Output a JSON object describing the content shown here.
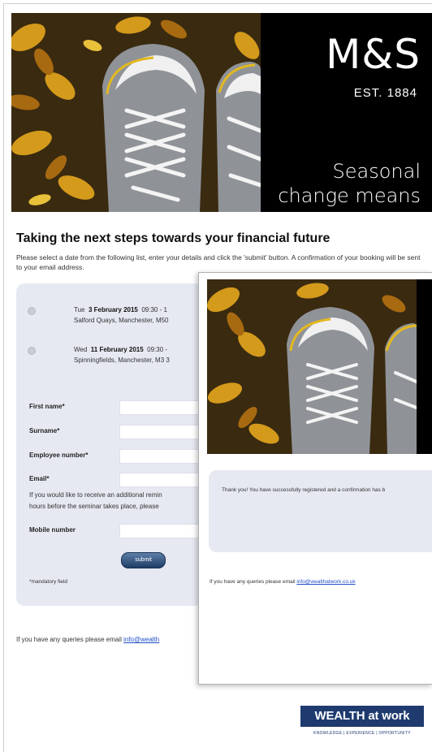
{
  "banner": {
    "brand": "M&S",
    "established": "EST. 1884",
    "tagline_line1": "Seasonal",
    "tagline_line2": "change means"
  },
  "page": {
    "heading": "Taking the next steps towards your financial future",
    "intro": "Please select a date from the following list, enter your details and click the 'submit' button. A confirmation of your booking will be sent to your email address."
  },
  "seminars": [
    {
      "day": "Tue",
      "date": "3 February 2015",
      "time": "09:30 - 1",
      "venue": "Salford Quays, Manchester, M50"
    },
    {
      "day": "Wed",
      "date": "11 February 2015",
      "time": "09:30 -",
      "venue": "Spinningfields, Manchester, M3 3"
    }
  ],
  "form": {
    "first_name": "First name*",
    "surname": "Surname*",
    "employee_number": "Employee number*",
    "email": "Email*",
    "reminder_line1": "If you would like to receive an additional remin",
    "reminder_line2": "hours before the seminar takes place, please",
    "mobile": "Mobile number",
    "submit": "submit",
    "mandatory": "*mandatory field"
  },
  "footer": {
    "queries": "If you have any queries please email",
    "email_link": "info@wealth"
  },
  "confirmation": {
    "message": "Thank you! You have successfully registered and a confirmation has b",
    "queries": "If you have any queries please email",
    "email_link": "info@wealthatwork.co.uk"
  },
  "sponsor": {
    "logo_text": "WEALTH at work",
    "strap": "KNOWLEDGE | EXPERIENCE | OPPORTUNITY"
  },
  "colors": {
    "accent": "#1e3a6e",
    "panel": "#e6e9f2",
    "link": "#2050c8"
  }
}
